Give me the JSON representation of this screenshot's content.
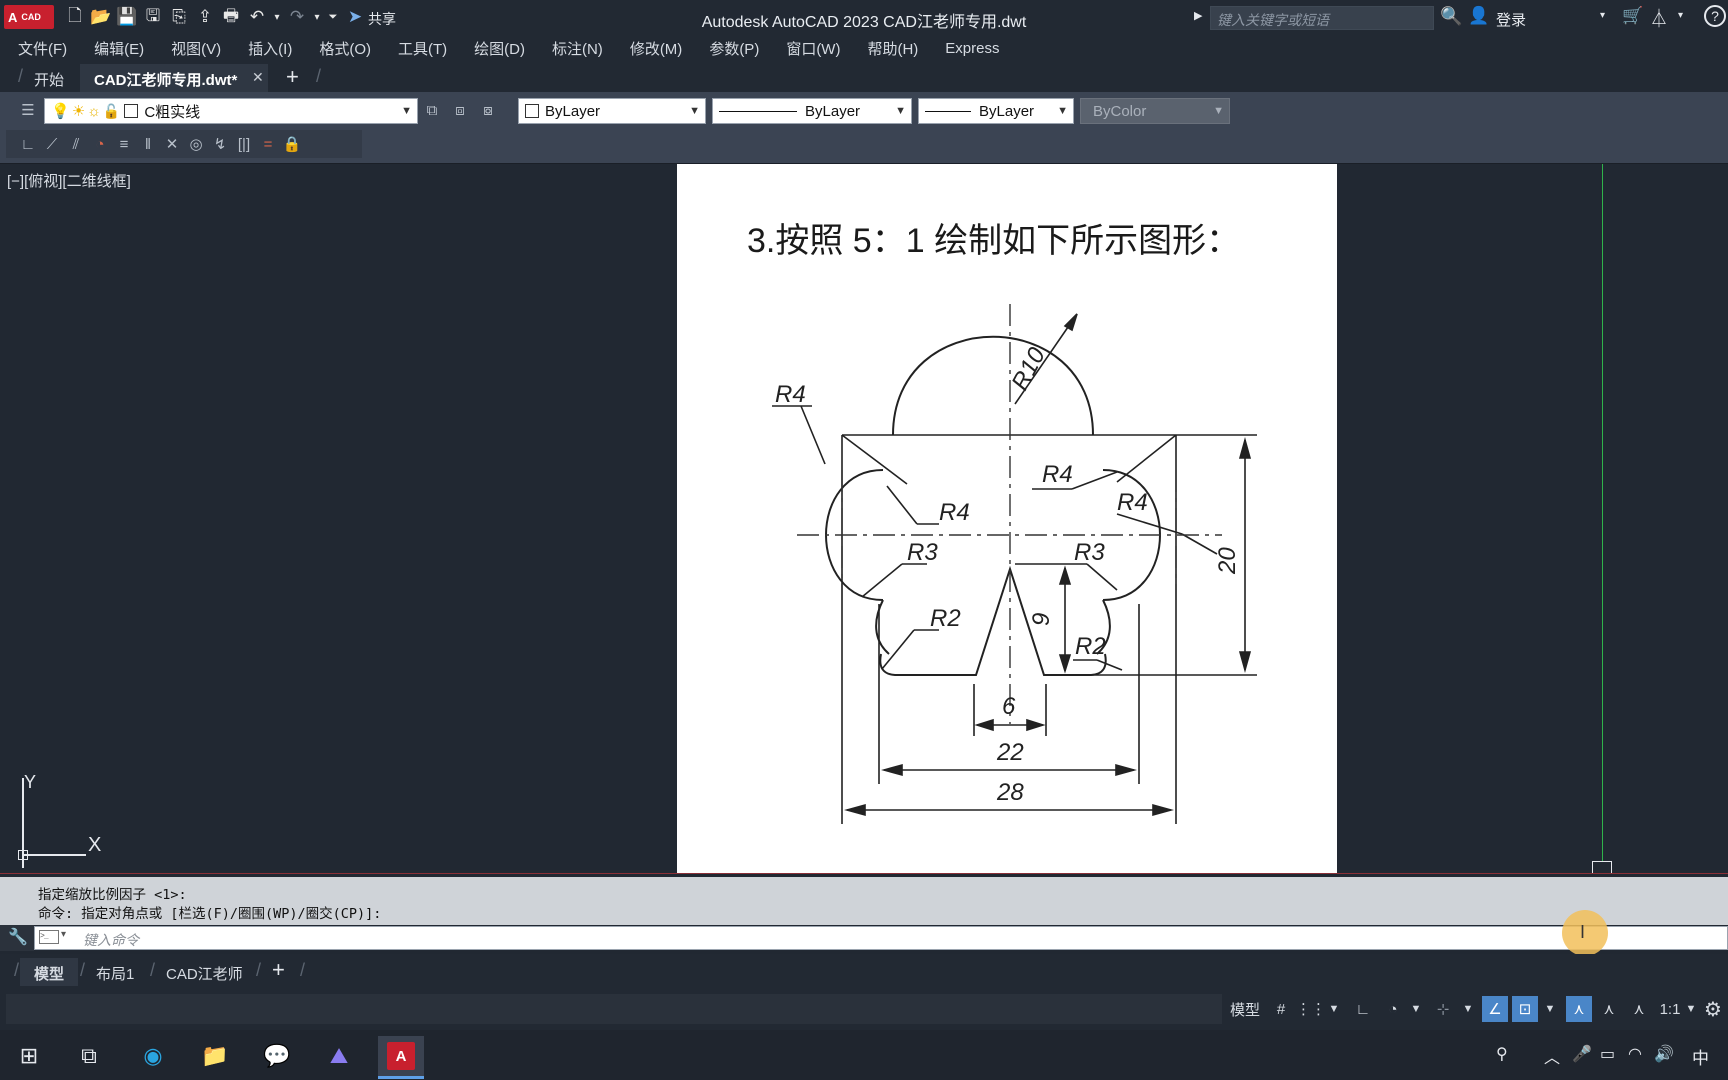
{
  "titlebar": {
    "logo_text": "A",
    "logo_sub": "CAD",
    "share_label": "共享",
    "app_title": "Autodesk AutoCAD 2023    CAD江老师专用.dwt",
    "search_placeholder": "键入关键字或短语",
    "login_label": "登录"
  },
  "menu": [
    "文件(F)",
    "编辑(E)",
    "视图(V)",
    "插入(I)",
    "格式(O)",
    "工具(T)",
    "绘图(D)",
    "标注(N)",
    "修改(M)",
    "参数(P)",
    "窗口(W)",
    "帮助(H)",
    "Express"
  ],
  "file_tabs": {
    "start": "开始",
    "active": "CAD江老师专用.dwt*",
    "close": "✕",
    "add": "+"
  },
  "layer": {
    "name": "C粗实线"
  },
  "properties": {
    "color": "ByLayer",
    "linetype": "ByLayer",
    "lineweight": "ByLayer",
    "plotstyle": "ByColor"
  },
  "viewport_label": "[−][俯视][二维线框]",
  "drawing": {
    "heading": "3.按照 5：1 绘制如下所示图形：",
    "labels": {
      "r10": "R10",
      "r4a": "R4",
      "r4b": "R4",
      "r4c": "R4",
      "r4d": "R4",
      "r3a": "R3",
      "r3b": "R3",
      "r2a": "R2",
      "r2b": "R2",
      "d9": "9",
      "d20": "20",
      "d6": "6",
      "d22": "22",
      "d28": "28"
    }
  },
  "ucs": {
    "x": "X",
    "y": "Y"
  },
  "command": {
    "line1": "指定缩放比例因子 <1>:",
    "line2": "命令: 指定对角点或 [栏选(F)/圈围(WP)/圈交(CP)]:",
    "placeholder": "键入命令"
  },
  "layout_tabs": [
    "模型",
    "布局1",
    "CAD江老师"
  ],
  "status": {
    "model": "模型",
    "scale": "1:1"
  },
  "taskbar": {
    "ime": "中"
  },
  "colors": {
    "accent": "#4a86c8",
    "logo": "#c8202e",
    "paper": "#ffffff",
    "canvas": "#212832"
  }
}
